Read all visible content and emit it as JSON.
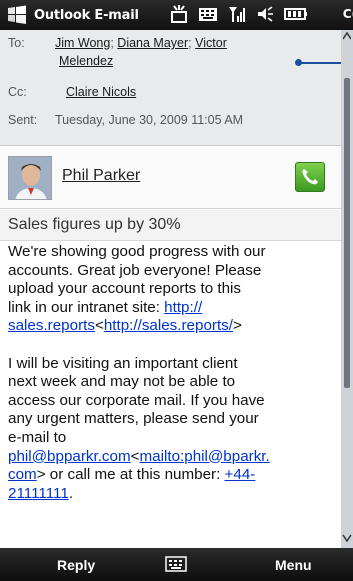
{
  "status_bar": {
    "title": "Outlook E-mail",
    "time_partial": "C(",
    "icons": [
      "windows-start-icon",
      "new-mail-icon",
      "keyboard-status-icon",
      "signal-icon",
      "volume-icon",
      "battery-icon"
    ]
  },
  "header": {
    "to_label": "To:",
    "to_recipients": [
      "Jim Wong",
      "Diana Mayer",
      "Victor",
      "Melendez"
    ],
    "cc_label": "Cc:",
    "cc_recipient": "Claire Nicols",
    "sent_label": "Sent:",
    "sent_value": "Tuesday, June 30, 2009 11:05 AM"
  },
  "contact": {
    "name": "Phil Parker",
    "call_icon": "phone-icon"
  },
  "subject": "Sales figures up by 30%",
  "body": {
    "p1_lines": [
      "We're showing good progress with our",
      "accounts. Great job everyone! Please",
      "upload your account reports to this",
      "link in our intranet site: "
    ],
    "link1_a": "http://",
    "link1_b": "sales.reports",
    "link1_c": "<",
    "link1_d": "http://sales.reports/",
    "link1_e": ">",
    "p2_lines": [
      "I will be visiting an important client",
      "next week and may not be able to",
      "access our corporate mail. If you have",
      "any urgent matters, please send your",
      "e-mail to"
    ],
    "email_a": "phil@bpparkr.com",
    "email_b": "<",
    "email_c": "mailto:phil@bparkr.",
    "email_d": "com",
    "email_e": "> or call me at this number: ",
    "phone_a": "+44-",
    "phone_b": "21111111",
    "phone_end": "."
  },
  "softkeys": {
    "left": "Reply",
    "right": "Menu",
    "center_icon": "keyboard-icon"
  },
  "colors": {
    "link": "#0033cc",
    "header_bg": "#e9eaec",
    "call_green": "#3a9a22",
    "pointer": "#1a4fa0"
  }
}
